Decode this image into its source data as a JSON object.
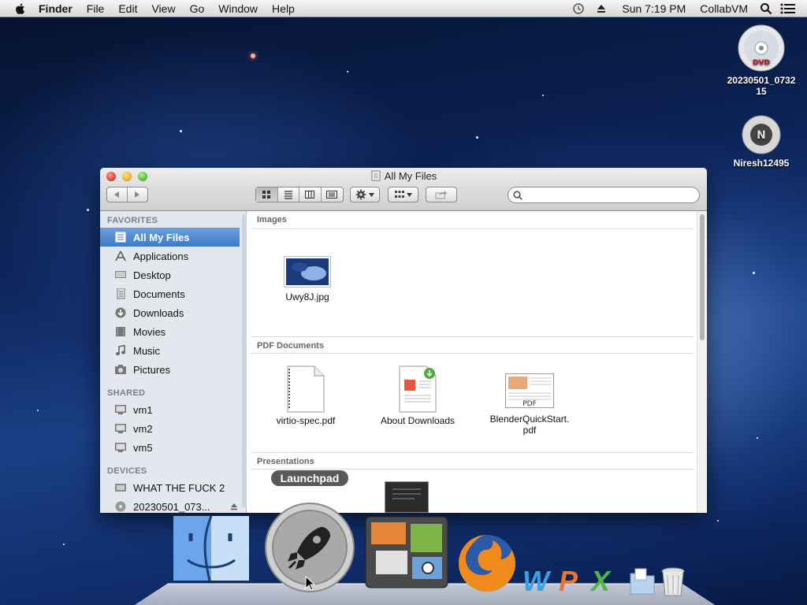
{
  "menubar": {
    "app_name": "Finder",
    "menus": [
      "File",
      "Edit",
      "View",
      "Go",
      "Window",
      "Help"
    ],
    "clock": "Sun 7:19 PM",
    "user": "CollabVM"
  },
  "desktop": {
    "icons": [
      {
        "label": "20230501_073215",
        "icon": "dvd-icon"
      },
      {
        "label": "Niresh12495",
        "icon": "disk-icon"
      }
    ]
  },
  "window": {
    "title": "All My Files",
    "search": {
      "value": "",
      "placeholder": ""
    }
  },
  "sidebar": {
    "favorites_heading": "FAVORITES",
    "favorites": [
      {
        "label": "All My Files",
        "icon": "all-files-icon",
        "selected": true
      },
      {
        "label": "Applications",
        "icon": "applications-icon"
      },
      {
        "label": "Desktop",
        "icon": "desktop-icon"
      },
      {
        "label": "Documents",
        "icon": "documents-icon"
      },
      {
        "label": "Downloads",
        "icon": "downloads-icon"
      },
      {
        "label": "Movies",
        "icon": "movies-icon"
      },
      {
        "label": "Music",
        "icon": "music-icon"
      },
      {
        "label": "Pictures",
        "icon": "pictures-icon"
      }
    ],
    "shared_heading": "SHARED",
    "shared": [
      {
        "label": "vm1",
        "icon": "computer-icon"
      },
      {
        "label": "vm2",
        "icon": "computer-icon"
      },
      {
        "label": "vm5",
        "icon": "computer-icon"
      }
    ],
    "devices_heading": "DEVICES",
    "devices": [
      {
        "label": "WHAT THE FUCK 2",
        "icon": "hard-drive-icon"
      },
      {
        "label": "20230501_073...",
        "icon": "optical-disc-icon"
      }
    ]
  },
  "content": {
    "sections": [
      {
        "title": "Images",
        "files": [
          {
            "name": "Uwy8J.jpg"
          }
        ]
      },
      {
        "title": "PDF Documents",
        "files": [
          {
            "name": "virtio-spec.pdf"
          },
          {
            "name": "About Downloads"
          },
          {
            "name": "BlenderQuickStart.pdf",
            "line1": "BlenderQuickStart.",
            "line2": "pdf",
            "badge": "PDF"
          }
        ]
      },
      {
        "title": "Presentations",
        "files": []
      }
    ]
  },
  "dock": {
    "tooltip": "Launchpad",
    "items": [
      "finder-icon",
      "launchpad-icon",
      "mission-control-icon",
      "firefox-icon",
      "word-icon",
      "powerpoint-icon",
      "excel-icon",
      "documents-stack-icon",
      "trash-icon"
    ],
    "word_letter": "W",
    "powerpoint_letter": "P",
    "excel_letter": "X"
  },
  "colors": {
    "selection": "#3f7ac6",
    "close": "#e0443e",
    "minimize": "#f0b030",
    "zoom": "#5bbf3a"
  }
}
